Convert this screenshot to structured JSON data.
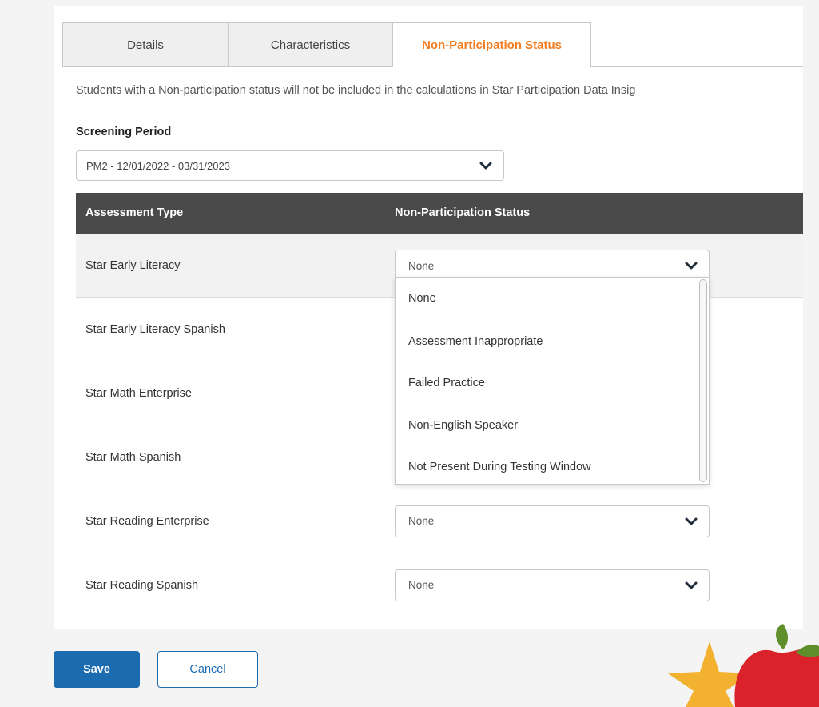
{
  "tabs": [
    {
      "label": "Details"
    },
    {
      "label": "Characteristics"
    },
    {
      "label": "Non-Participation Status"
    }
  ],
  "intro_text": "Students with a Non-participation status will not be included in the calculations in Star Participation Data Insig",
  "screening_period": {
    "label": "Screening Period",
    "selected": "PM2 - 12/01/2022 - 03/31/2023"
  },
  "table": {
    "headers": [
      "Assessment Type",
      "Non-Participation Status"
    ],
    "rows": [
      {
        "assessment": "Star Early Literacy",
        "status": "None"
      },
      {
        "assessment": "Star Early Literacy Spanish",
        "status": ""
      },
      {
        "assessment": "Star Math Enterprise",
        "status": ""
      },
      {
        "assessment": "Star Math Spanish",
        "status": ""
      },
      {
        "assessment": "Star Reading Enterprise",
        "status": "None"
      },
      {
        "assessment": "Star Reading Spanish",
        "status": "None"
      }
    ]
  },
  "dropdown_options": [
    "None",
    "Assessment Inappropriate",
    "Failed Practice",
    "Non-English Speaker",
    "Not Present During Testing Window"
  ],
  "buttons": {
    "save": "Save",
    "cancel": "Cancel"
  },
  "colors": {
    "accent_orange": "#f47c20",
    "primary_blue": "#1b6bb0",
    "header_dark": "#4a4a4a"
  }
}
